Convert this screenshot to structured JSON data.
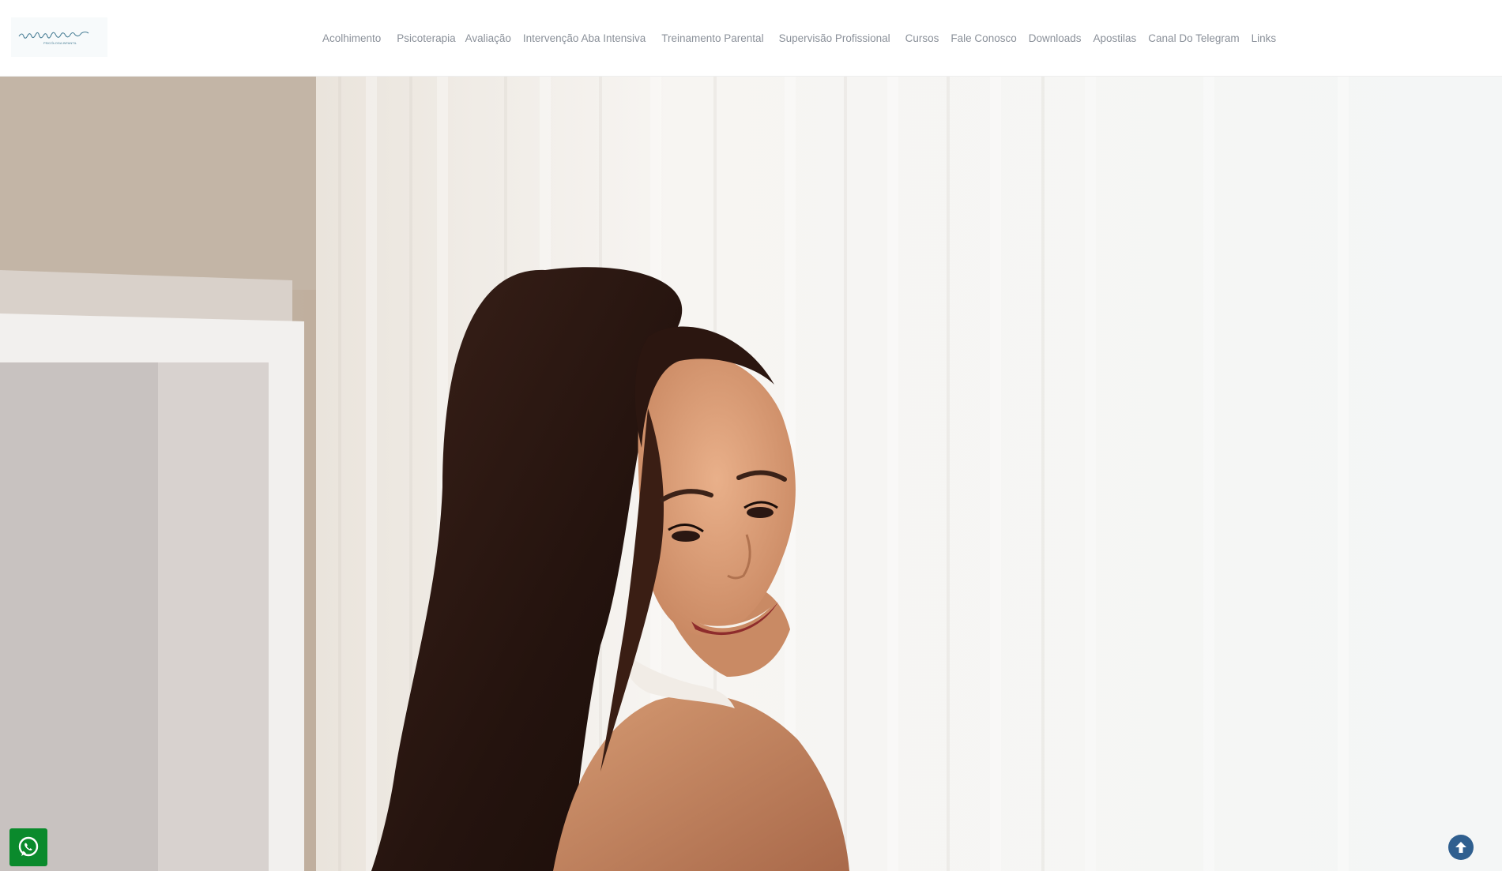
{
  "brand": {
    "logo_text": "camylle azevedo",
    "logo_subtext": "PSICÓLOGA INFANTIL",
    "logo_color": "#4a7f96"
  },
  "nav": {
    "items": [
      {
        "label": "Acolhimento"
      },
      {
        "label": "Psicoterapia"
      },
      {
        "label": "Avaliação"
      },
      {
        "label": "Intervenção Aba Intensiva"
      },
      {
        "label": "Treinamento Parental"
      },
      {
        "label": "Supervisão Profissional"
      },
      {
        "label": "Cursos"
      },
      {
        "label": "Fale Conosco"
      },
      {
        "label": "Downloads"
      },
      {
        "label": "Apostilas"
      },
      {
        "label": "Canal Do Telegram"
      },
      {
        "label": "Links"
      }
    ],
    "color": "#8a9099"
  },
  "hero": {
    "image_alt": "smiling-woman-by-window"
  },
  "floating": {
    "whatsapp_icon": "whatsapp-icon",
    "whatsapp_color": "#0a8a2c",
    "back_to_top_icon": "arrow-up-icon",
    "back_to_top_color": "#2f5f8f"
  }
}
